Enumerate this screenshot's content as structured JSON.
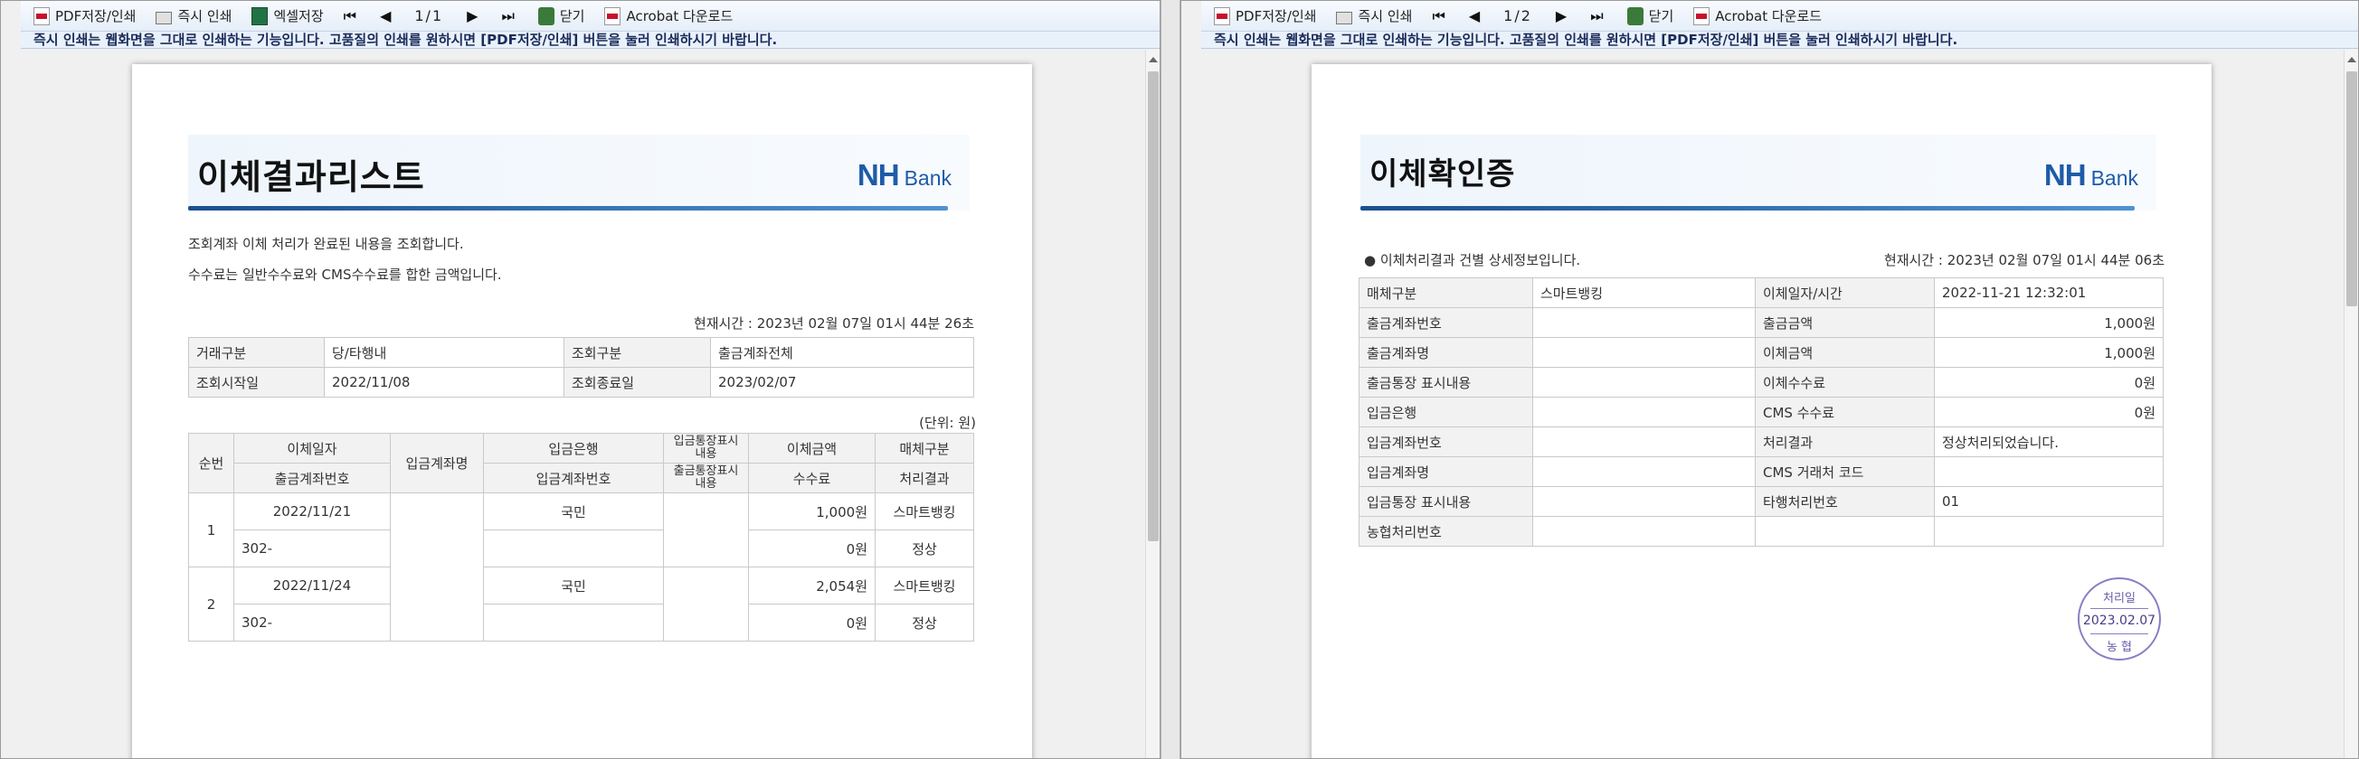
{
  "toolbar": {
    "pdf_label": "PDF저장/인쇄",
    "print_label": "즉시 인쇄",
    "excel_label": "엑셀저장",
    "first": "⏮",
    "prev": "◀",
    "next": "▶",
    "last": "⏭",
    "close_label": "닫기",
    "acrobat_label": "Acrobat 다운로드"
  },
  "notice": "즉시 인쇄는 웹화면을 그대로 인쇄하는 기능입니다. 고품질의 인쇄를 원하시면 [PDF저장/인쇄] 버튼을 눌러 인쇄하시기 바랍니다.",
  "left": {
    "page_indicator": "1/1",
    "title": "이체결과리스트",
    "logo_nh": "NH",
    "logo_bank": "Bank",
    "desc1": "조회계좌 이체 처리가 완료된 내용을 조회합니다.",
    "desc2": "수수료는 일반수수료와 CMS수수료를 합한 금액입니다.",
    "current_time": "현재시간 : 2023년 02월 07일 01시 44분 26초",
    "query": {
      "trade_type_label": "거래구분",
      "trade_type": "당/타행내",
      "query_type_label": "조회구분",
      "query_type": "출금계좌전체",
      "start_label": "조회시작일",
      "start": "2022/11/08",
      "end_label": "조회종료일",
      "end": "2023/02/07"
    },
    "unit": "(단위: 원)",
    "headers": {
      "seq": "순번",
      "date": "이체일자",
      "out_acct": "출금계좌번호",
      "in_name": "입금계좌명",
      "in_bank": "입금은행",
      "in_acct": "입금계좌번호",
      "memo1": "입금통장표시내용",
      "memo2": "출금통장표시내용",
      "amount": "이체금액",
      "fee": "수수료",
      "media": "매체구분",
      "result": "처리결과"
    },
    "rows": [
      {
        "seq": "1",
        "date": "2022/11/21",
        "out_acct": "302-",
        "bank": "국민",
        "amount": "1,000원",
        "fee": "0원",
        "media": "스마트뱅킹",
        "result": "정상"
      },
      {
        "seq": "2",
        "date": "2022/11/24",
        "out_acct": "302-",
        "bank": "국민",
        "amount": "2,054원",
        "fee": "0원",
        "media": "스마트뱅킹",
        "result": "정상"
      }
    ]
  },
  "right": {
    "page_indicator": "1/2",
    "title": "이체확인증",
    "logo_nh": "NH",
    "logo_bank": "Bank",
    "desc": "● 이체처리결과 건별 상세정보입니다.",
    "current_time": "현재시간 : 2023년 02월 07일 01시 44분 06초",
    "detail": [
      {
        "l1": "매체구분",
        "v1": "스마트뱅킹",
        "l2": "이체일자/시간",
        "v2": "2022-11-21 12:32:01"
      },
      {
        "l1": "출금계좌번호",
        "v1": "",
        "l2": "출금금액",
        "v2": "1,000원"
      },
      {
        "l1": "출금계좌명",
        "v1": "",
        "l2": "이체금액",
        "v2": "1,000원"
      },
      {
        "l1": "출금통장 표시내용",
        "v1": "",
        "l2": "이체수수료",
        "v2": "0원"
      },
      {
        "l1": "입금은행",
        "v1": "",
        "l2": "CMS 수수료",
        "v2": "0원"
      },
      {
        "l1": "입금계좌번호",
        "v1": "",
        "l2": "처리결과",
        "v2": "정상처리되었습니다."
      },
      {
        "l1": "입금계좌명",
        "v1": "",
        "l2": "CMS 거래처 코드",
        "v2": ""
      },
      {
        "l1": "입금통장 표시내용",
        "v1": "",
        "l2": "타행처리번호",
        "v2": "01"
      },
      {
        "l1": "농협처리번호",
        "v1": "",
        "l2": "",
        "v2": ""
      }
    ],
    "seal": {
      "top": "처리일",
      "date": "2023.02.07",
      "bottom": "농  협"
    }
  }
}
